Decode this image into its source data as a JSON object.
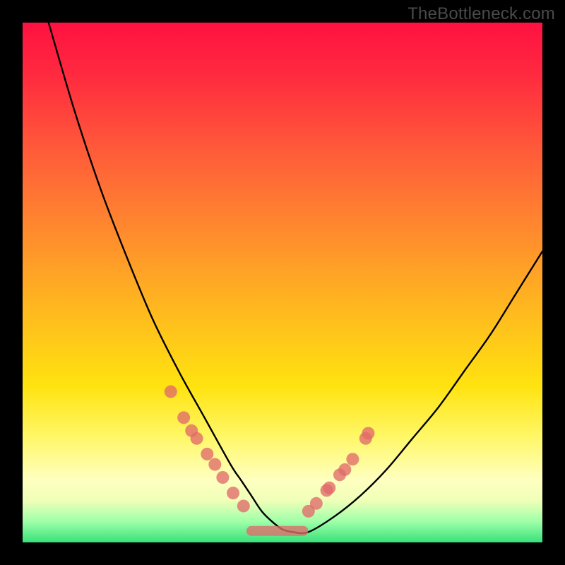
{
  "watermark": "TheBottleneck.com",
  "colors": {
    "dot": "#e06a6a",
    "curve": "#000000",
    "frame": "#000000"
  },
  "chart_data": {
    "type": "line",
    "title": "",
    "xlabel": "",
    "ylabel": "",
    "xlim": [
      0,
      100
    ],
    "ylim": [
      0,
      100
    ],
    "grid": false,
    "legend": false,
    "series": [
      {
        "name": "bottleneck-curve",
        "x": [
          5,
          10,
          15,
          20,
          25,
          30,
          35,
          40,
          42,
          44,
          46,
          48,
          50,
          52,
          55,
          60,
          65,
          70,
          75,
          80,
          85,
          90,
          95,
          100
        ],
        "values": [
          100,
          83,
          68,
          55,
          43,
          33,
          24,
          15,
          12,
          9,
          6,
          4,
          2.5,
          2,
          2,
          5,
          9,
          14,
          20,
          26,
          33,
          40,
          48,
          56
        ]
      }
    ],
    "markers": {
      "name": "highlight-dots",
      "x": [
        28.5,
        31,
        32.5,
        33.5,
        35.5,
        37,
        38.5,
        40.5,
        42.5,
        55,
        56.5,
        58.5,
        59,
        61,
        62,
        63.5,
        66,
        66.5
      ],
      "values": [
        29,
        24,
        21.5,
        20,
        17,
        15,
        12.5,
        9.5,
        7,
        6,
        7.5,
        10,
        10.5,
        13,
        14,
        16,
        20,
        21
      ],
      "r": 9
    },
    "trough_band": {
      "x_start": 44,
      "x_end": 54,
      "y": 2.2
    }
  }
}
